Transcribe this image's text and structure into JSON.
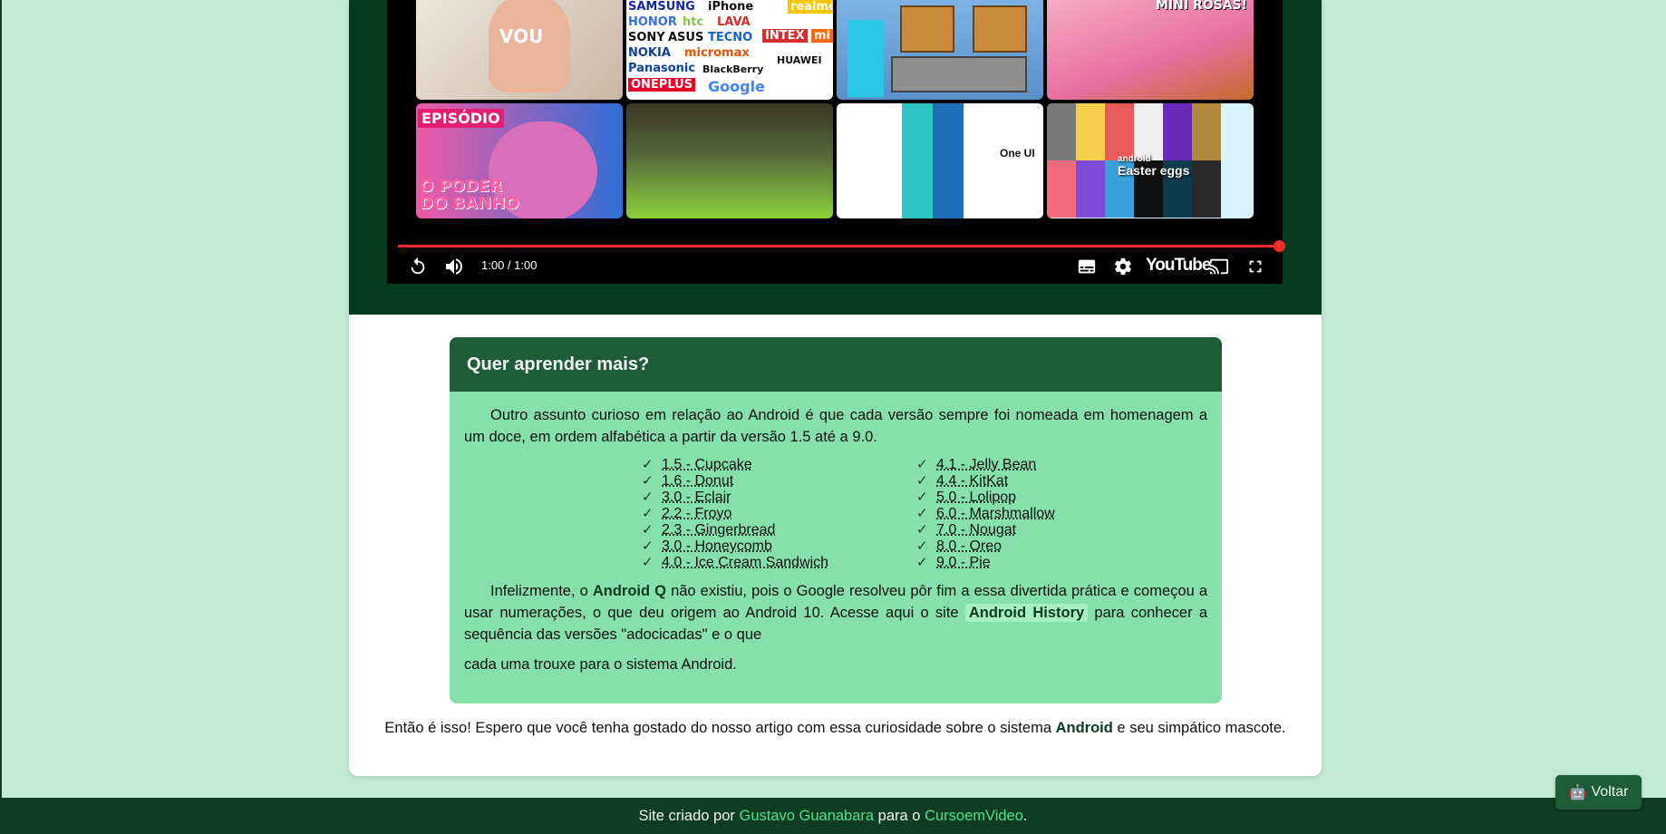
{
  "video": {
    "thumbnails": [
      {
        "id": "you",
        "text": "VOU"
      },
      {
        "id": "brands",
        "brands": [
          "SAMSUNG",
          "iPhone",
          "realme",
          "HONOR",
          "htc",
          "LAVA",
          "SONY",
          "ASUS",
          "TECNO",
          "INTEX",
          "mi",
          "NOKIA",
          "micromax",
          "Panasonic",
          "BlackBerry",
          "HUAWEI",
          "ONEPLUS",
          "Google"
        ]
      },
      {
        "id": "game",
        "text": ""
      },
      {
        "id": "rosas",
        "text": "MINI ROSAS!"
      },
      {
        "id": "bear",
        "badge": "EPISÓDIO",
        "title_line1": "O PODER",
        "title_line2": "DO BANHO"
      },
      {
        "id": "minecraft",
        "text": ""
      },
      {
        "id": "android-versions",
        "text": "One UI"
      },
      {
        "id": "easter-eggs",
        "text": "Easter eggs",
        "small": "android"
      }
    ],
    "time": "1:00 / 1:00",
    "progress": 1.0,
    "logo": "YouTube"
  },
  "card": {
    "title": "Quer aprender mais?",
    "intro": "Outro assunto curioso em relação ao Android é que cada versão sempre foi nomeada em homenagem a um doce, em ordem alfabética a partir da versão 1.5 até a 9.0.",
    "left_list": [
      "1.5 - Cupcake",
      "1.6 - Donut",
      "3.0 - Eclair",
      "2.2 - Froyo",
      "2.3 - Gingerbread",
      "3.0 - Honeycomb",
      "4.0 - Ice Cream Sandwich"
    ],
    "right_list": [
      "4.1 - Jelly Bean",
      "4.4 - KitKat",
      "5.0 - Lolipop",
      "6.0 - Marshmallow",
      "7.0 - Nougat",
      "8.0 - Oreo",
      "9.0 - Pie"
    ],
    "p2_a": "Infelizmente, o ",
    "p2_strong": "Android Q",
    "p2_b": " não existiu, pois o Google resolveu pôr fim a essa divertida prática e começou a usar numerações, o que deu origem ao Android 10. Acesse aqui o site ",
    "p2_link": "Android History",
    "p2_c": " para conhecer a sequência das versões \"adocicadas\" e o que",
    "p3": "cada uma trouxe para o sistema Android."
  },
  "closing": {
    "a": "Então é isso! Espero que você tenha gostado do nosso artigo com essa curiosidade sobre o sistema ",
    "strong": "Android",
    "b": " e seu simpático mascote."
  },
  "footer": {
    "a": "Site criado por ",
    "author": "Gustavo Guanabara",
    "b": " para o ",
    "site": "CursoemVideo",
    "c": "."
  },
  "back_button": {
    "icon": "robot-icon",
    "label": "Voltar"
  }
}
